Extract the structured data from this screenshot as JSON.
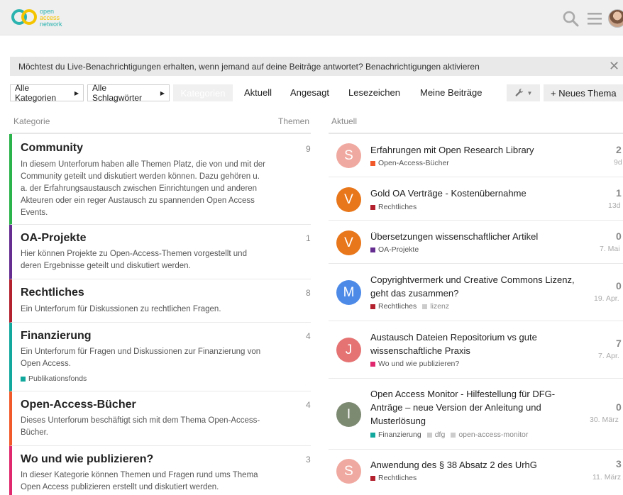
{
  "header": {
    "logo": {
      "line1": "open",
      "line2": "access",
      "line3": "network"
    }
  },
  "banner": {
    "text": "Möchtest du Live-Benachrichtigungen erhalten, wenn jemand auf deine Beiträge antwortet? Benachrichtigungen aktivieren",
    "close": "✕"
  },
  "nav": {
    "all_categories": "Alle Kategorien",
    "all_tags": "Alle Schlagwörter",
    "active": "Kategorien",
    "links": [
      "Aktuell",
      "Angesagt",
      "Lesezeichen",
      "Meine Beiträge"
    ],
    "new_topic": "+ Neues Thema"
  },
  "columns": {
    "category": "Kategorie",
    "topics": "Themen",
    "latest": "Aktuell"
  },
  "categories": [
    {
      "title": "Community",
      "count": "9",
      "color": "#2ab34b",
      "desc": "In diesem Unterforum haben alle Themen Platz, die von und mit der Community geteilt und diskutiert werden können. Dazu gehören u. a. der Erfahrungsaustausch zwischen Einrichtungen und anderen Akteuren oder ein reger Austausch zu spannenden Open Access Events."
    },
    {
      "title": "OA-Projekte",
      "count": "1",
      "color": "#652d90",
      "desc": "Hier können Projekte zu Open-Access-Themen vorgestellt und deren Ergebnisse geteilt und diskutiert werden."
    },
    {
      "title": "Rechtliches",
      "count": "8",
      "color": "#b3202e",
      "desc": "Ein Unterforum für Diskussionen zu rechtlichen Fragen."
    },
    {
      "title": "Finanzierung",
      "count": "4",
      "color": "#12a89d",
      "desc": "Ein Unterforum für Fragen und Diskussionen zur Finanzierung von Open Access.",
      "subcategory": "Publikationsfonds"
    },
    {
      "title": "Open-Access-Bücher",
      "count": "4",
      "color": "#f1592a",
      "desc": "Dieses Unterforum beschäftigt sich mit dem Thema Open-Access-Bücher."
    },
    {
      "title": "Wo und wie publizieren?",
      "count": "3",
      "color": "#e0286e",
      "desc": "In dieser Kategorie können Themen und Fragen rund ums Thema Open Access publizieren erstellt und diskutiert werden."
    }
  ],
  "topics": [
    {
      "avatar": "S",
      "avatar_color": "#f0a9a0",
      "title": "Erfahrungen mit Open Research Library",
      "category": "Open-Access-Bücher",
      "cat_color": "#f1592a",
      "tags": [],
      "count": "2",
      "date": "9d"
    },
    {
      "avatar": "V",
      "avatar_color": "#e8761a",
      "title": "Gold OA Verträge - Kostenübernahme",
      "category": "Rechtliches",
      "cat_color": "#b3202e",
      "tags": [],
      "count": "1",
      "date": "13d"
    },
    {
      "avatar": "V",
      "avatar_color": "#e8761a",
      "title": "Übersetzungen wissenschaftlicher Artikel",
      "category": "OA-Projekte",
      "cat_color": "#652d90",
      "tags": [],
      "count": "0",
      "date": "7. Mai"
    },
    {
      "avatar": "M",
      "avatar_color": "#4d8ae8",
      "title": "Copyrightvermerk und Creative Commons Lizenz, geht das zusammen?",
      "category": "Rechtliches",
      "cat_color": "#b3202e",
      "tags": [
        "lizenz"
      ],
      "count": "0",
      "date": "19. Apr."
    },
    {
      "avatar": "J",
      "avatar_color": "#e57373",
      "title": "Austausch Dateien Repositorium vs gute wissenschaftliche Praxis",
      "category": "Wo und wie publizieren?",
      "cat_color": "#e0286e",
      "tags": [],
      "count": "7",
      "date": "7. Apr."
    },
    {
      "avatar": "I",
      "avatar_color": "#7d8a72",
      "title": "Open Access Monitor - Hilfestellung für DFG-Anträge – neue Version der Anleitung und Musterlösung",
      "category": "Finanzierung",
      "cat_color": "#12a89d",
      "tags": [
        "dfg",
        "open-access-monitor"
      ],
      "count": "0",
      "date": "30. März"
    },
    {
      "avatar": "S",
      "avatar_color": "#f0a9a0",
      "title": "Anwendung des § 38 Absatz 2 des UrhG",
      "category": "Rechtliches",
      "cat_color": "#b3202e",
      "tags": [],
      "count": "3",
      "date": "11. März"
    }
  ]
}
